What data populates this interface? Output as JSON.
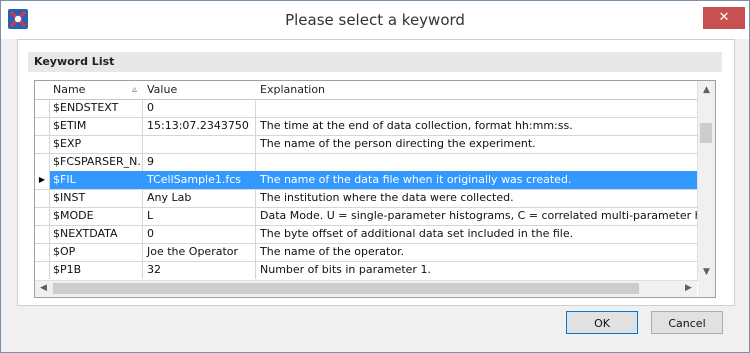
{
  "window": {
    "title": "Please select a keyword",
    "close_glyph": "✕"
  },
  "group": {
    "title": "Keyword List"
  },
  "grid": {
    "columns": [
      {
        "label": "Name",
        "sort": "▵"
      },
      {
        "label": "Value"
      },
      {
        "label": "Explanation"
      }
    ],
    "rows": [
      {
        "name": "$ENDSTEXT",
        "value": "0",
        "explanation": ""
      },
      {
        "name": "$ETIM",
        "value": "15:13:07.2343750",
        "explanation": "The time at the end of data collection, format hh:mm:ss."
      },
      {
        "name": "$EXP",
        "value": "",
        "explanation": "The name of the person directing the experiment."
      },
      {
        "name": "$FCSPARSER_N...",
        "value": "9",
        "explanation": ""
      },
      {
        "name": "$FIL",
        "value": "TCellSample1.fcs",
        "explanation": "The name of the data file when it originally was created.",
        "selected": true
      },
      {
        "name": "$INST",
        "value": "Any Lab",
        "explanation": "The institution where the data were collected."
      },
      {
        "name": "$MODE",
        "value": "L",
        "explanation": "Data Mode.  U = single-parameter histograms, C = correlated multi-parameter histogr"
      },
      {
        "name": "$NEXTDATA",
        "value": "0",
        "explanation": "The byte offset of additional data set included in the file."
      },
      {
        "name": "$OP",
        "value": "Joe the Operator",
        "explanation": "The name of the operator."
      },
      {
        "name": "$P1B",
        "value": "32",
        "explanation": "Number of bits in parameter 1."
      }
    ],
    "current_row_glyph": "▶"
  },
  "buttons": {
    "ok": "OK",
    "cancel": "Cancel"
  },
  "colors": {
    "selection": "#3399ff",
    "close": "#c75050"
  }
}
